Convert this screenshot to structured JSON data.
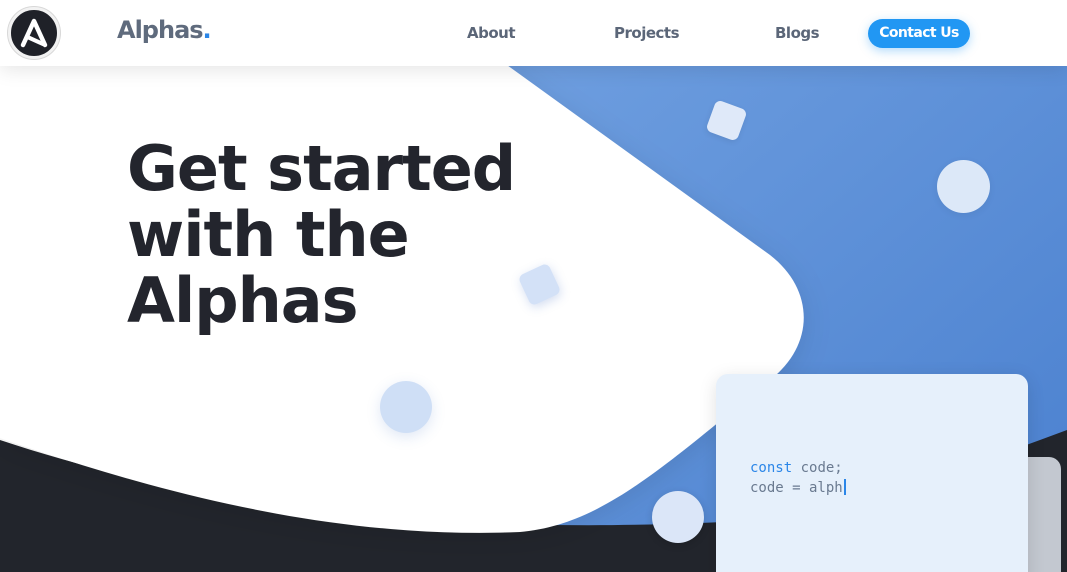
{
  "brand": {
    "name": "Alphas",
    "dot": "."
  },
  "nav": {
    "about": "About",
    "projects": "Projects",
    "blogs": "Blogs",
    "contact": "Contact Us"
  },
  "hero": {
    "title_lines": [
      "Get started",
      "with the",
      "Alphas"
    ]
  },
  "code_card": {
    "line1_keyword": "const",
    "line1_rest": " code;",
    "line2": "code = alph"
  },
  "colors": {
    "accent": "#2197f3",
    "dark": "#23252d",
    "blue_panel": "#5b8ed8",
    "card": "#e6f0fb"
  },
  "icons": {
    "logo": "logo-a-icon"
  }
}
